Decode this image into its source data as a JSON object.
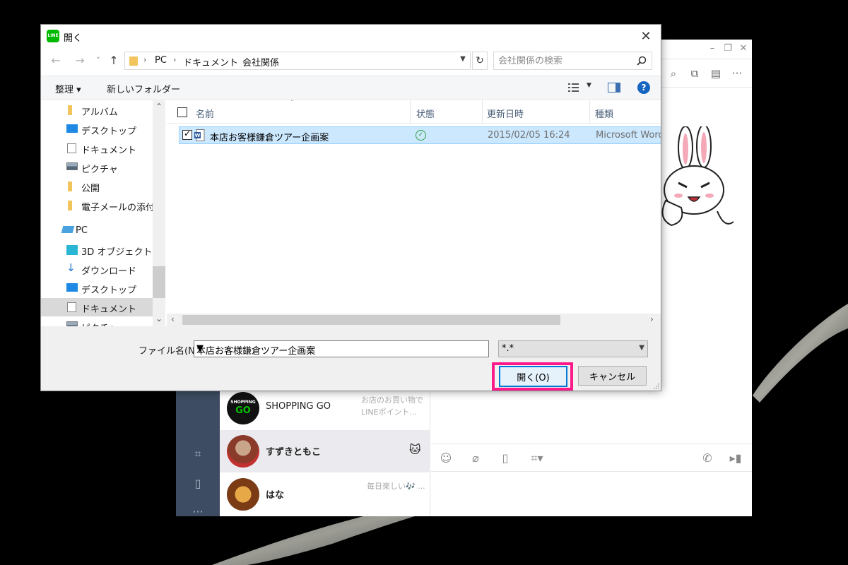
{
  "dialog": {
    "title": "開く",
    "close_glyph": "✕",
    "nav": {
      "back": "←",
      "forward": "→",
      "recent": "˅",
      "up": "↑"
    },
    "address": {
      "crumbs": [
        "PC",
        "ドキュメント",
        "会社関係"
      ],
      "separator": "›"
    },
    "refresh_glyph": "↻",
    "search_placeholder": "会社関係の検索",
    "commands": {
      "organize": "整理 ▾",
      "new_folder": "新しいフォルダー"
    },
    "help_glyph": "?",
    "nav_pane": [
      {
        "label": "アルバム",
        "icon": "folder-icon"
      },
      {
        "label": "デスクトップ",
        "icon": "desktop-icon"
      },
      {
        "label": "ドキュメント",
        "icon": "documents-icon"
      },
      {
        "label": "ピクチャ",
        "icon": "pictures-icon"
      },
      {
        "label": "公開",
        "icon": "folder-icon"
      },
      {
        "label": "電子メールの添付フ",
        "icon": "folder-icon"
      },
      {
        "label": "PC",
        "icon": "pc-icon"
      },
      {
        "label": "3D オブジェクト",
        "icon": "3d-objects-icon"
      },
      {
        "label": "ダウンロード",
        "icon": "download-icon"
      },
      {
        "label": "デスクトップ",
        "icon": "desktop-icon"
      },
      {
        "label": "ドキュメント",
        "icon": "documents-icon",
        "selected": true
      },
      {
        "label": "ピクチャ",
        "icon": "pictures-icon"
      }
    ],
    "columns": {
      "name": "名前",
      "status": "状態",
      "modified": "更新日時",
      "type": "種類"
    },
    "files": [
      {
        "name": "本店お客様鎌倉ツアー企画案",
        "status": "synced",
        "modified": "2015/02/05 16:24",
        "type": "Microsoft Word",
        "checked": true,
        "icon": "word-doc-icon"
      }
    ],
    "filename_label": "ファイル名(N):",
    "filename_value": "本店お客様鎌倉ツアー企画案",
    "filetype_value": "*.*",
    "open_label": "開く(O)",
    "cancel_label": "キャンセル",
    "highlight_color": "#ff1a8c"
  },
  "line": {
    "chats": [
      {
        "name": "SHOPPING GO",
        "preview": "お店のお買い物でLINEポイント...",
        "avatar_text": "SHOPPING",
        "avatar_text2": "GO"
      },
      {
        "name": "すずきともこ",
        "preview": "",
        "emoji": "🐱",
        "selected": true
      },
      {
        "name": "はな",
        "preview": "毎日楽しい🎶 ..."
      }
    ],
    "window_controls": [
      "–",
      "❐",
      "✕"
    ],
    "brand_color": "#00b900"
  }
}
